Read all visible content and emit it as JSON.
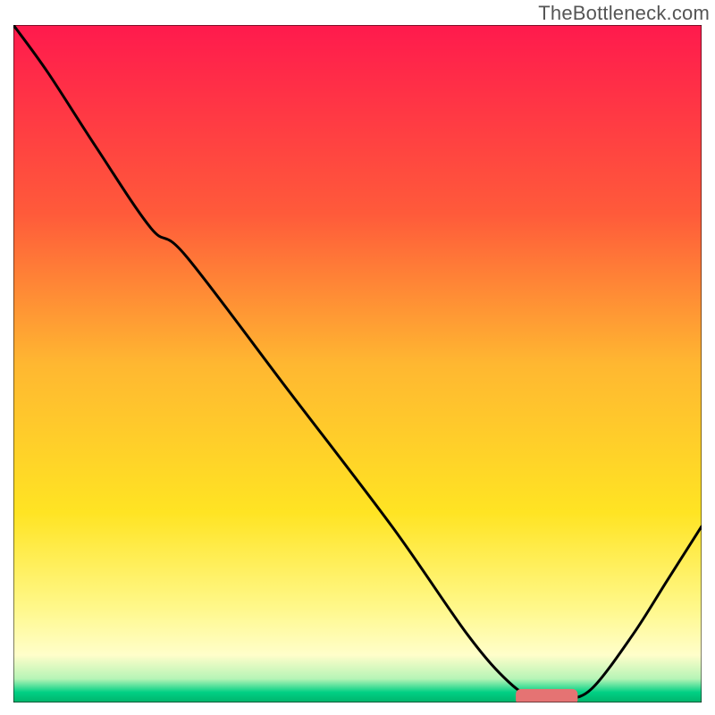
{
  "watermark": "TheBottleneck.com",
  "chart_data": {
    "type": "line",
    "title": "",
    "xlabel": "",
    "ylabel": "",
    "xlim": [
      0,
      100
    ],
    "ylim": [
      0,
      100
    ],
    "grid": false,
    "background_gradient_stops": [
      {
        "offset": 0.0,
        "color": "#ff1a4d"
      },
      {
        "offset": 0.28,
        "color": "#ff5b3a"
      },
      {
        "offset": 0.5,
        "color": "#ffb731"
      },
      {
        "offset": 0.72,
        "color": "#ffe423"
      },
      {
        "offset": 0.86,
        "color": "#fff88a"
      },
      {
        "offset": 0.93,
        "color": "#fffeca"
      },
      {
        "offset": 0.965,
        "color": "#b6f4b6"
      },
      {
        "offset": 0.985,
        "color": "#00d084"
      },
      {
        "offset": 1.0,
        "color": "#00b36b"
      }
    ],
    "series": [
      {
        "name": "bottleneck-curve",
        "color": "#000000",
        "stroke_width": 3,
        "x": [
          0,
          5,
          12,
          20,
          25,
          40,
          55,
          66,
          72,
          76,
          80,
          84,
          90,
          95,
          100
        ],
        "y": [
          100,
          93,
          82,
          70,
          66,
          46,
          26,
          10,
          3,
          0.5,
          0.5,
          2,
          10,
          18,
          26
        ]
      }
    ],
    "markers": [
      {
        "name": "optimal-zone",
        "shape": "rounded-rect",
        "color": "#e57373",
        "x_start": 73,
        "x_end": 82,
        "y": 0.8,
        "height": 2.4
      }
    ]
  }
}
